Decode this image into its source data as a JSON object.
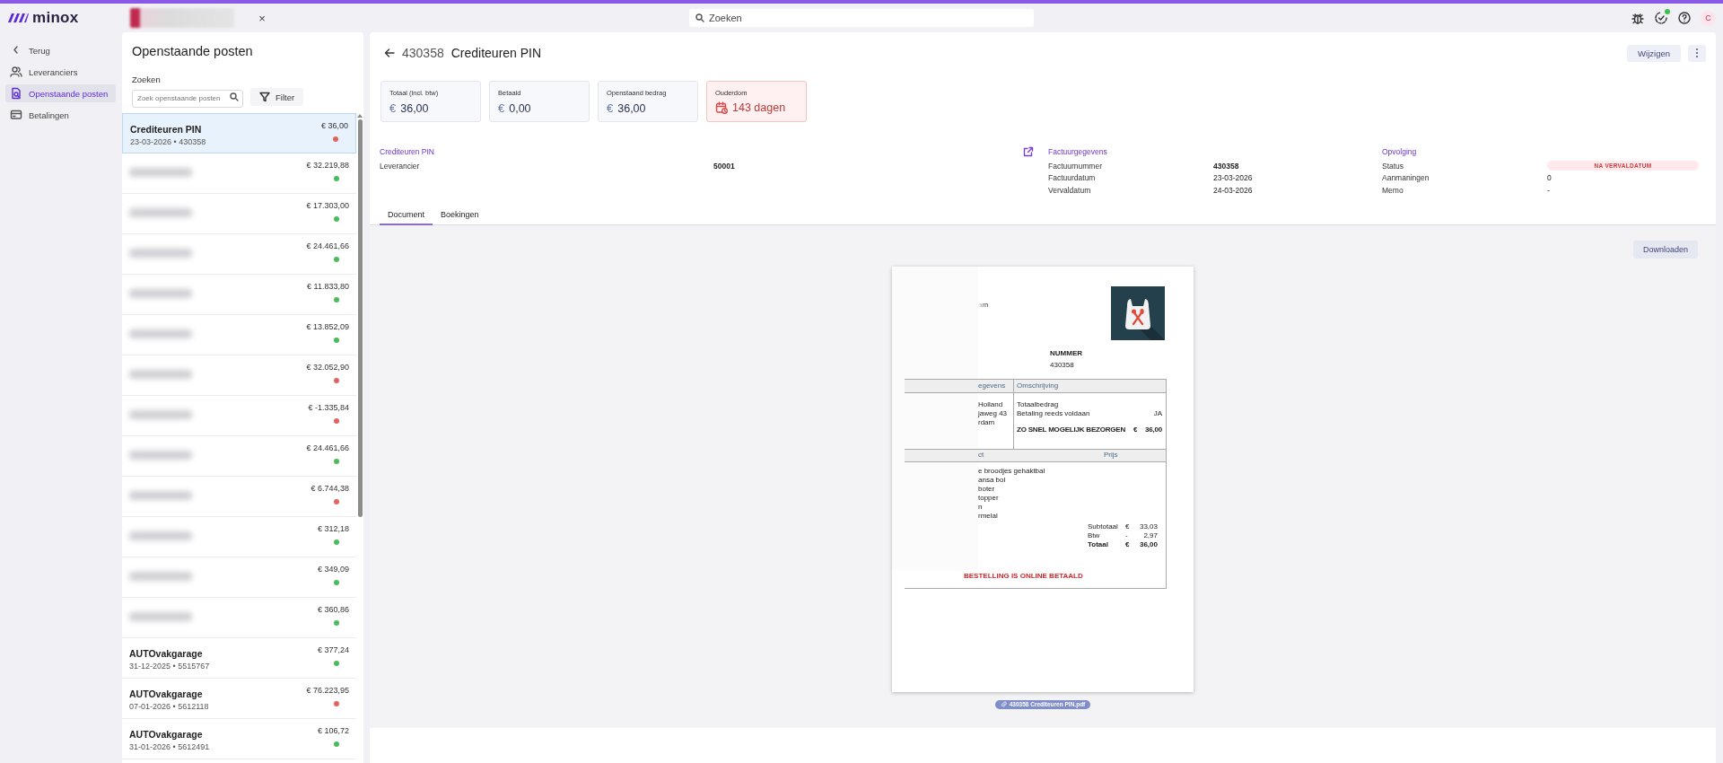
{
  "topbar": {
    "brand": "minox",
    "search": {
      "placeholder": "Zoeken"
    },
    "tab_close": "×",
    "avatar": "C",
    "notification_dot": true
  },
  "sidebar": {
    "items": [
      {
        "label": "Terug",
        "selected": false
      },
      {
        "label": "Leveranciers",
        "selected": false
      },
      {
        "label": "Openstaande posten",
        "selected": true
      },
      {
        "label": "Betalingen",
        "selected": false
      }
    ]
  },
  "list": {
    "title": "Openstaande posten",
    "search_label": "Zoeken",
    "search": {
      "placeholder": "Zoek openstaande posten"
    },
    "filter_button": "Filter",
    "items": [
      {
        "kind": "named",
        "name": "Crediteuren PIN",
        "meta": "23-03-2026 • 430358",
        "amount": "€ 36,00",
        "color": "#e06464",
        "selected": true
      },
      {
        "kind": "redacted",
        "amount": "€ 32.219,88",
        "color": "#4cbb5c",
        "selected": false
      },
      {
        "kind": "redacted",
        "amount": "€ 17.303,00",
        "color": "#4cbb5c",
        "selected": false
      },
      {
        "kind": "redacted",
        "amount": "€ 24.461,66",
        "color": "#4cbb5c",
        "selected": false
      },
      {
        "kind": "redacted",
        "amount": "€ 11.833,80",
        "color": "#4cbb5c",
        "selected": false
      },
      {
        "kind": "redacted",
        "amount": "€ 13.852,09",
        "color": "#4cbb5c",
        "selected": false
      },
      {
        "kind": "redacted",
        "amount": "€ 32.052,90",
        "color": "#e06464",
        "selected": false
      },
      {
        "kind": "redacted",
        "amount": "€ -1.335,84",
        "color": "#e06464",
        "selected": false
      },
      {
        "kind": "redacted",
        "amount": "€ 24.461,66",
        "color": "#4cbb5c",
        "selected": false
      },
      {
        "kind": "redacted",
        "amount": "€ 6.744,38",
        "color": "#e06464",
        "selected": false
      },
      {
        "kind": "redacted",
        "amount": "€ 312,18",
        "color": "#4cbb5c",
        "selected": false
      },
      {
        "kind": "redacted",
        "amount": "€ 349,09",
        "color": "#4cbb5c",
        "selected": false
      },
      {
        "kind": "redacted",
        "amount": "€ 360,86",
        "color": "#4cbb5c",
        "selected": false
      },
      {
        "kind": "named",
        "name": "AUTOvakgarage",
        "meta": "31-12-2025 • 5515767",
        "amount": "€ 377,24",
        "color": "#4cbb5c",
        "selected": false
      },
      {
        "kind": "named",
        "name": "AUTOvakgarage",
        "meta": "07-01-2026 • 5612118",
        "amount": "€ 76.223,95",
        "color": "#e06464",
        "selected": false
      },
      {
        "kind": "named",
        "name": "AUTOvakgarage",
        "meta": "31-01-2026 • 5612491",
        "amount": "€ 106,72",
        "color": "#4cbb5c",
        "selected": false
      }
    ]
  },
  "detail": {
    "number": "430358",
    "title": "Crediteuren PIN",
    "edit_button": "Wijzigen",
    "cards": [
      {
        "kind": "amount",
        "label": "Totaal (incl. btw)",
        "currency": "€",
        "value": "36,00"
      },
      {
        "kind": "amount",
        "label": "Betaald",
        "currency": "€",
        "value": "0,00"
      },
      {
        "kind": "amount",
        "label": "Openstaand bedrag",
        "currency": "€",
        "value": "36,00"
      },
      {
        "kind": "alert",
        "label": "Ouderdom",
        "value": "143 dagen"
      }
    ],
    "groups": [
      {
        "title": "Crediteuren PIN",
        "external_link": true,
        "rows": [
          {
            "label": "Leverancier",
            "value": "50001",
            "bold": true
          }
        ]
      },
      {
        "title": "Factuurgegevens",
        "external_link": false,
        "rows": [
          {
            "label": "Factuurnummer",
            "value": "430358",
            "bold": true
          },
          {
            "label": "Factuurdatum",
            "value": "23-03-2026",
            "bold": false
          },
          {
            "label": "Vervaldatum",
            "value": "24-03-2026",
            "bold": false
          }
        ]
      },
      {
        "title": "Opvolging",
        "external_link": false,
        "rows": [
          {
            "label": "Status",
            "value": "NA VERVALDATUM",
            "kind": "pill"
          },
          {
            "label": "Aanmaningen",
            "value": "0",
            "bold": false
          },
          {
            "label": "Memo",
            "value": "-",
            "bold": false
          }
        ]
      }
    ],
    "tabs": [
      {
        "label": "Document",
        "selected": true
      },
      {
        "label": "Boekingen",
        "selected": false
      }
    ],
    "download_button": "Downloaden",
    "document": {
      "sender_fragment": "am",
      "number_label": "NUMMER",
      "number": "430358",
      "section1": {
        "left_heading": "egevens",
        "right_heading": "Omschrijving",
        "left_lines": [
          "Holland",
          "jaweg 43",
          "rdam"
        ],
        "right_rows": [
          {
            "label": "Totaalbedrag",
            "bold": false
          },
          {
            "label": "Betaling reeds voldaan",
            "value": "JA",
            "bold": false
          },
          {
            "label": "ZO SNEL MOGELIJK BEZORGEN",
            "currency": "€",
            "value": "36,00",
            "bold": true
          }
        ]
      },
      "section2": {
        "left_heading": "ct",
        "right_heading": "Prijs",
        "items": [
          "e broodjes gehaktbal",
          "ansa bol",
          "boter",
          "topper",
          "n",
          "rmelal"
        ],
        "totals": [
          {
            "label": "Subtotaal",
            "sign": "€",
            "value": "33,03",
            "bold": false
          },
          {
            "label": "Btw",
            "sign": "-",
            "value": "2,97",
            "bold": false
          },
          {
            "label": "Totaal",
            "sign": "€",
            "value": "36,00",
            "bold": true
          }
        ]
      },
      "note": "BESTELLING IS ONLINE BETAALD"
    },
    "file_chip": "430358 Crediteuren PIN.pdf"
  }
}
